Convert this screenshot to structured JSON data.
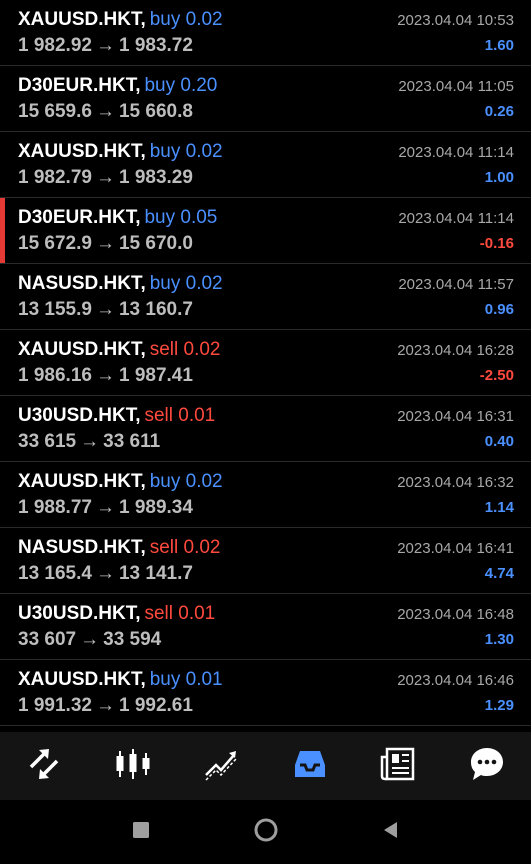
{
  "positions": [
    {
      "symbol": "XAUUSD.HKT,",
      "type": "buy",
      "volume": "buy 0.02",
      "open": "1 982.92",
      "close": "1 983.72",
      "time": "2023.04.04 10:53",
      "profit": "1.60",
      "highlight": false
    },
    {
      "symbol": "D30EUR.HKT,",
      "type": "buy",
      "volume": "buy 0.20",
      "open": "15 659.6",
      "close": "15 660.8",
      "time": "2023.04.04 11:05",
      "profit": "0.26",
      "highlight": false
    },
    {
      "symbol": "XAUUSD.HKT,",
      "type": "buy",
      "volume": "buy 0.02",
      "open": "1 982.79",
      "close": "1 983.29",
      "time": "2023.04.04 11:14",
      "profit": "1.00",
      "highlight": false
    },
    {
      "symbol": "D30EUR.HKT,",
      "type": "buy",
      "volume": "buy 0.05",
      "open": "15 672.9",
      "close": "15 670.0",
      "time": "2023.04.04 11:14",
      "profit": "-0.16",
      "highlight": true
    },
    {
      "symbol": "NASUSD.HKT,",
      "type": "buy",
      "volume": "buy 0.02",
      "open": "13 155.9",
      "close": "13 160.7",
      "time": "2023.04.04 11:57",
      "profit": "0.96",
      "highlight": false
    },
    {
      "symbol": "XAUUSD.HKT,",
      "type": "sell",
      "volume": "sell 0.02",
      "open": "1 986.16",
      "close": "1 987.41",
      "time": "2023.04.04 16:28",
      "profit": "-2.50",
      "highlight": false
    },
    {
      "symbol": "U30USD.HKT,",
      "type": "sell",
      "volume": "sell 0.01",
      "open": "33 615",
      "close": "33 611",
      "time": "2023.04.04 16:31",
      "profit": "0.40",
      "highlight": false
    },
    {
      "symbol": "XAUUSD.HKT,",
      "type": "buy",
      "volume": "buy 0.02",
      "open": "1 988.77",
      "close": "1 989.34",
      "time": "2023.04.04 16:32",
      "profit": "1.14",
      "highlight": false
    },
    {
      "symbol": "NASUSD.HKT,",
      "type": "sell",
      "volume": "sell 0.02",
      "open": "13 165.4",
      "close": "13 141.7",
      "time": "2023.04.04 16:41",
      "profit": "4.74",
      "highlight": false
    },
    {
      "symbol": "U30USD.HKT,",
      "type": "sell",
      "volume": "sell 0.01",
      "open": "33 607",
      "close": "33 594",
      "time": "2023.04.04 16:48",
      "profit": "1.30",
      "highlight": false
    },
    {
      "symbol": "XAUUSD.HKT,",
      "type": "buy",
      "volume": "buy 0.01",
      "open": "1 991.32",
      "close": "1 992.61",
      "time": "2023.04.04 16:46",
      "profit": "1.29",
      "highlight": false
    }
  ],
  "toolbar": {
    "items": [
      {
        "icon": "quotes-arrows-icon",
        "active": false
      },
      {
        "icon": "candlestick-chart-icon",
        "active": false
      },
      {
        "icon": "trade-chart-icon",
        "active": false
      },
      {
        "icon": "history-inbox-icon",
        "active": true
      },
      {
        "icon": "news-icon",
        "active": false
      },
      {
        "icon": "chat-bubble-icon",
        "active": false
      }
    ],
    "active_color": "#4a90ff",
    "inactive_color": "#ffffff"
  },
  "navbar": {
    "items": [
      {
        "icon": "recents-square-icon"
      },
      {
        "icon": "home-circle-icon"
      },
      {
        "icon": "back-triangle-icon"
      }
    ]
  },
  "colors": {
    "buy": "#4a90ff",
    "sell": "#ff4a3d",
    "profit_positive": "#4a90ff",
    "profit_negative": "#ff4a3d",
    "highlight_bar": "#e53935"
  }
}
